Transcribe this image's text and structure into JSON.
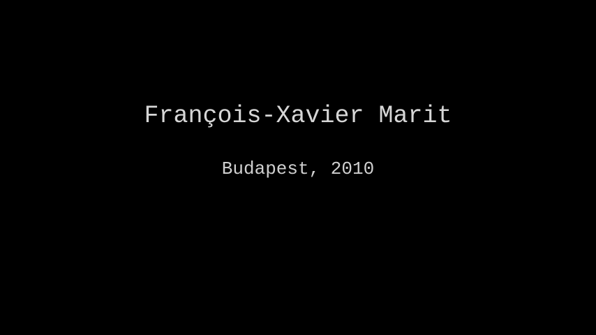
{
  "title": "François-Xavier Marit",
  "subtitle": "Budapest, 2010",
  "colors": {
    "background": "#000000",
    "text": "#d6d6d6"
  }
}
